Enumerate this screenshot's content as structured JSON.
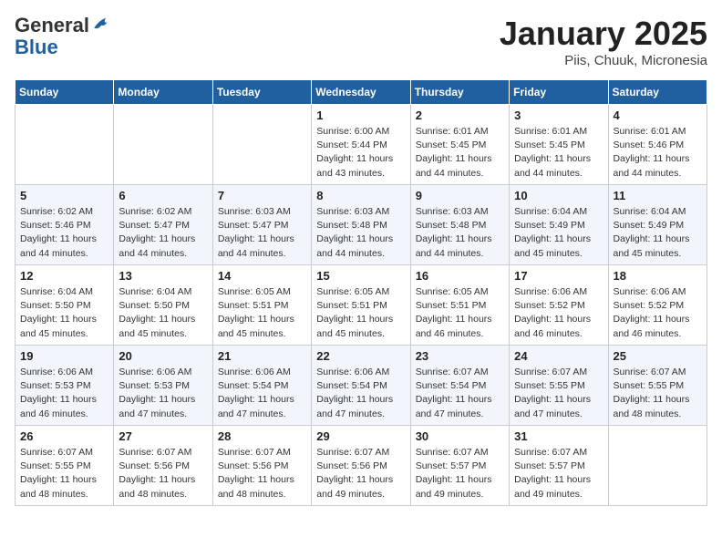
{
  "header": {
    "logo_general": "General",
    "logo_blue": "Blue",
    "month": "January 2025",
    "location": "Piis, Chuuk, Micronesia"
  },
  "days_of_week": [
    "Sunday",
    "Monday",
    "Tuesday",
    "Wednesday",
    "Thursday",
    "Friday",
    "Saturday"
  ],
  "weeks": [
    [
      {
        "day": "",
        "info": ""
      },
      {
        "day": "",
        "info": ""
      },
      {
        "day": "",
        "info": ""
      },
      {
        "day": "1",
        "info": "Sunrise: 6:00 AM\nSunset: 5:44 PM\nDaylight: 11 hours and 43 minutes."
      },
      {
        "day": "2",
        "info": "Sunrise: 6:01 AM\nSunset: 5:45 PM\nDaylight: 11 hours and 44 minutes."
      },
      {
        "day": "3",
        "info": "Sunrise: 6:01 AM\nSunset: 5:45 PM\nDaylight: 11 hours and 44 minutes."
      },
      {
        "day": "4",
        "info": "Sunrise: 6:01 AM\nSunset: 5:46 PM\nDaylight: 11 hours and 44 minutes."
      }
    ],
    [
      {
        "day": "5",
        "info": "Sunrise: 6:02 AM\nSunset: 5:46 PM\nDaylight: 11 hours and 44 minutes."
      },
      {
        "day": "6",
        "info": "Sunrise: 6:02 AM\nSunset: 5:47 PM\nDaylight: 11 hours and 44 minutes."
      },
      {
        "day": "7",
        "info": "Sunrise: 6:03 AM\nSunset: 5:47 PM\nDaylight: 11 hours and 44 minutes."
      },
      {
        "day": "8",
        "info": "Sunrise: 6:03 AM\nSunset: 5:48 PM\nDaylight: 11 hours and 44 minutes."
      },
      {
        "day": "9",
        "info": "Sunrise: 6:03 AM\nSunset: 5:48 PM\nDaylight: 11 hours and 44 minutes."
      },
      {
        "day": "10",
        "info": "Sunrise: 6:04 AM\nSunset: 5:49 PM\nDaylight: 11 hours and 45 minutes."
      },
      {
        "day": "11",
        "info": "Sunrise: 6:04 AM\nSunset: 5:49 PM\nDaylight: 11 hours and 45 minutes."
      }
    ],
    [
      {
        "day": "12",
        "info": "Sunrise: 6:04 AM\nSunset: 5:50 PM\nDaylight: 11 hours and 45 minutes."
      },
      {
        "day": "13",
        "info": "Sunrise: 6:04 AM\nSunset: 5:50 PM\nDaylight: 11 hours and 45 minutes."
      },
      {
        "day": "14",
        "info": "Sunrise: 6:05 AM\nSunset: 5:51 PM\nDaylight: 11 hours and 45 minutes."
      },
      {
        "day": "15",
        "info": "Sunrise: 6:05 AM\nSunset: 5:51 PM\nDaylight: 11 hours and 45 minutes."
      },
      {
        "day": "16",
        "info": "Sunrise: 6:05 AM\nSunset: 5:51 PM\nDaylight: 11 hours and 46 minutes."
      },
      {
        "day": "17",
        "info": "Sunrise: 6:06 AM\nSunset: 5:52 PM\nDaylight: 11 hours and 46 minutes."
      },
      {
        "day": "18",
        "info": "Sunrise: 6:06 AM\nSunset: 5:52 PM\nDaylight: 11 hours and 46 minutes."
      }
    ],
    [
      {
        "day": "19",
        "info": "Sunrise: 6:06 AM\nSunset: 5:53 PM\nDaylight: 11 hours and 46 minutes."
      },
      {
        "day": "20",
        "info": "Sunrise: 6:06 AM\nSunset: 5:53 PM\nDaylight: 11 hours and 47 minutes."
      },
      {
        "day": "21",
        "info": "Sunrise: 6:06 AM\nSunset: 5:54 PM\nDaylight: 11 hours and 47 minutes."
      },
      {
        "day": "22",
        "info": "Sunrise: 6:06 AM\nSunset: 5:54 PM\nDaylight: 11 hours and 47 minutes."
      },
      {
        "day": "23",
        "info": "Sunrise: 6:07 AM\nSunset: 5:54 PM\nDaylight: 11 hours and 47 minutes."
      },
      {
        "day": "24",
        "info": "Sunrise: 6:07 AM\nSunset: 5:55 PM\nDaylight: 11 hours and 47 minutes."
      },
      {
        "day": "25",
        "info": "Sunrise: 6:07 AM\nSunset: 5:55 PM\nDaylight: 11 hours and 48 minutes."
      }
    ],
    [
      {
        "day": "26",
        "info": "Sunrise: 6:07 AM\nSunset: 5:55 PM\nDaylight: 11 hours and 48 minutes."
      },
      {
        "day": "27",
        "info": "Sunrise: 6:07 AM\nSunset: 5:56 PM\nDaylight: 11 hours and 48 minutes."
      },
      {
        "day": "28",
        "info": "Sunrise: 6:07 AM\nSunset: 5:56 PM\nDaylight: 11 hours and 48 minutes."
      },
      {
        "day": "29",
        "info": "Sunrise: 6:07 AM\nSunset: 5:56 PM\nDaylight: 11 hours and 49 minutes."
      },
      {
        "day": "30",
        "info": "Sunrise: 6:07 AM\nSunset: 5:57 PM\nDaylight: 11 hours and 49 minutes."
      },
      {
        "day": "31",
        "info": "Sunrise: 6:07 AM\nSunset: 5:57 PM\nDaylight: 11 hours and 49 minutes."
      },
      {
        "day": "",
        "info": ""
      }
    ]
  ]
}
